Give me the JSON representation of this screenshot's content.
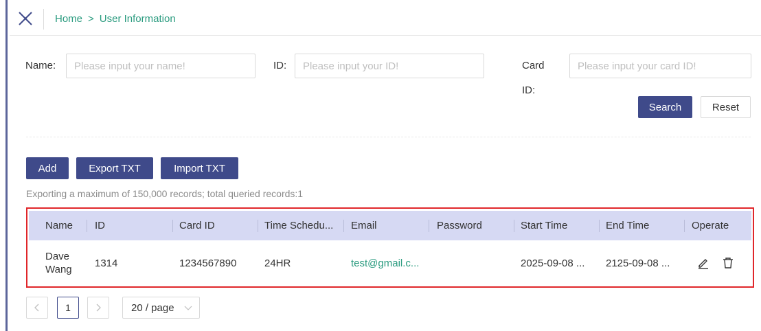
{
  "breadcrumb": {
    "home": "Home",
    "separator": ">",
    "current": "User Information"
  },
  "filters": {
    "name_label": "Name:",
    "name_placeholder": "Please input your name!",
    "id_label": "ID:",
    "id_placeholder": "Please input your ID!",
    "card_label": "Card ID:",
    "card_placeholder": "Please input your card ID!"
  },
  "actions": {
    "search": "Search",
    "reset": "Reset",
    "add": "Add",
    "export": "Export TXT",
    "import": "Import TXT"
  },
  "export_note": "Exporting a maximum of 150,000 records; total queried records:1",
  "table": {
    "headers": [
      "Name",
      "ID",
      "Card ID",
      "Time Schedu...",
      "Email",
      "Password",
      "Start Time",
      "End Time",
      "Operate"
    ],
    "rows": [
      {
        "name_line1": "Dave",
        "name_line2": "Wang",
        "id": "1314",
        "card_id": "1234567890",
        "time_schedule": "24HR",
        "email": "test@gmail.c...",
        "password": "",
        "start_time": "2025-09-08 ...",
        "end_time": "2125-09-08 ..."
      }
    ]
  },
  "pagination": {
    "current_page": "1",
    "page_size": "20 / page"
  },
  "colors": {
    "primary": "#3f4a8a",
    "link": "#2a9b7f",
    "header_bg": "#d6d9f3",
    "highlight_border": "#e0262a"
  },
  "icons": {
    "close": "close-icon",
    "edit": "edit-icon",
    "delete": "trash-icon",
    "prev": "chevron-left-icon",
    "next": "chevron-right-icon",
    "dropdown": "chevron-down-icon"
  }
}
